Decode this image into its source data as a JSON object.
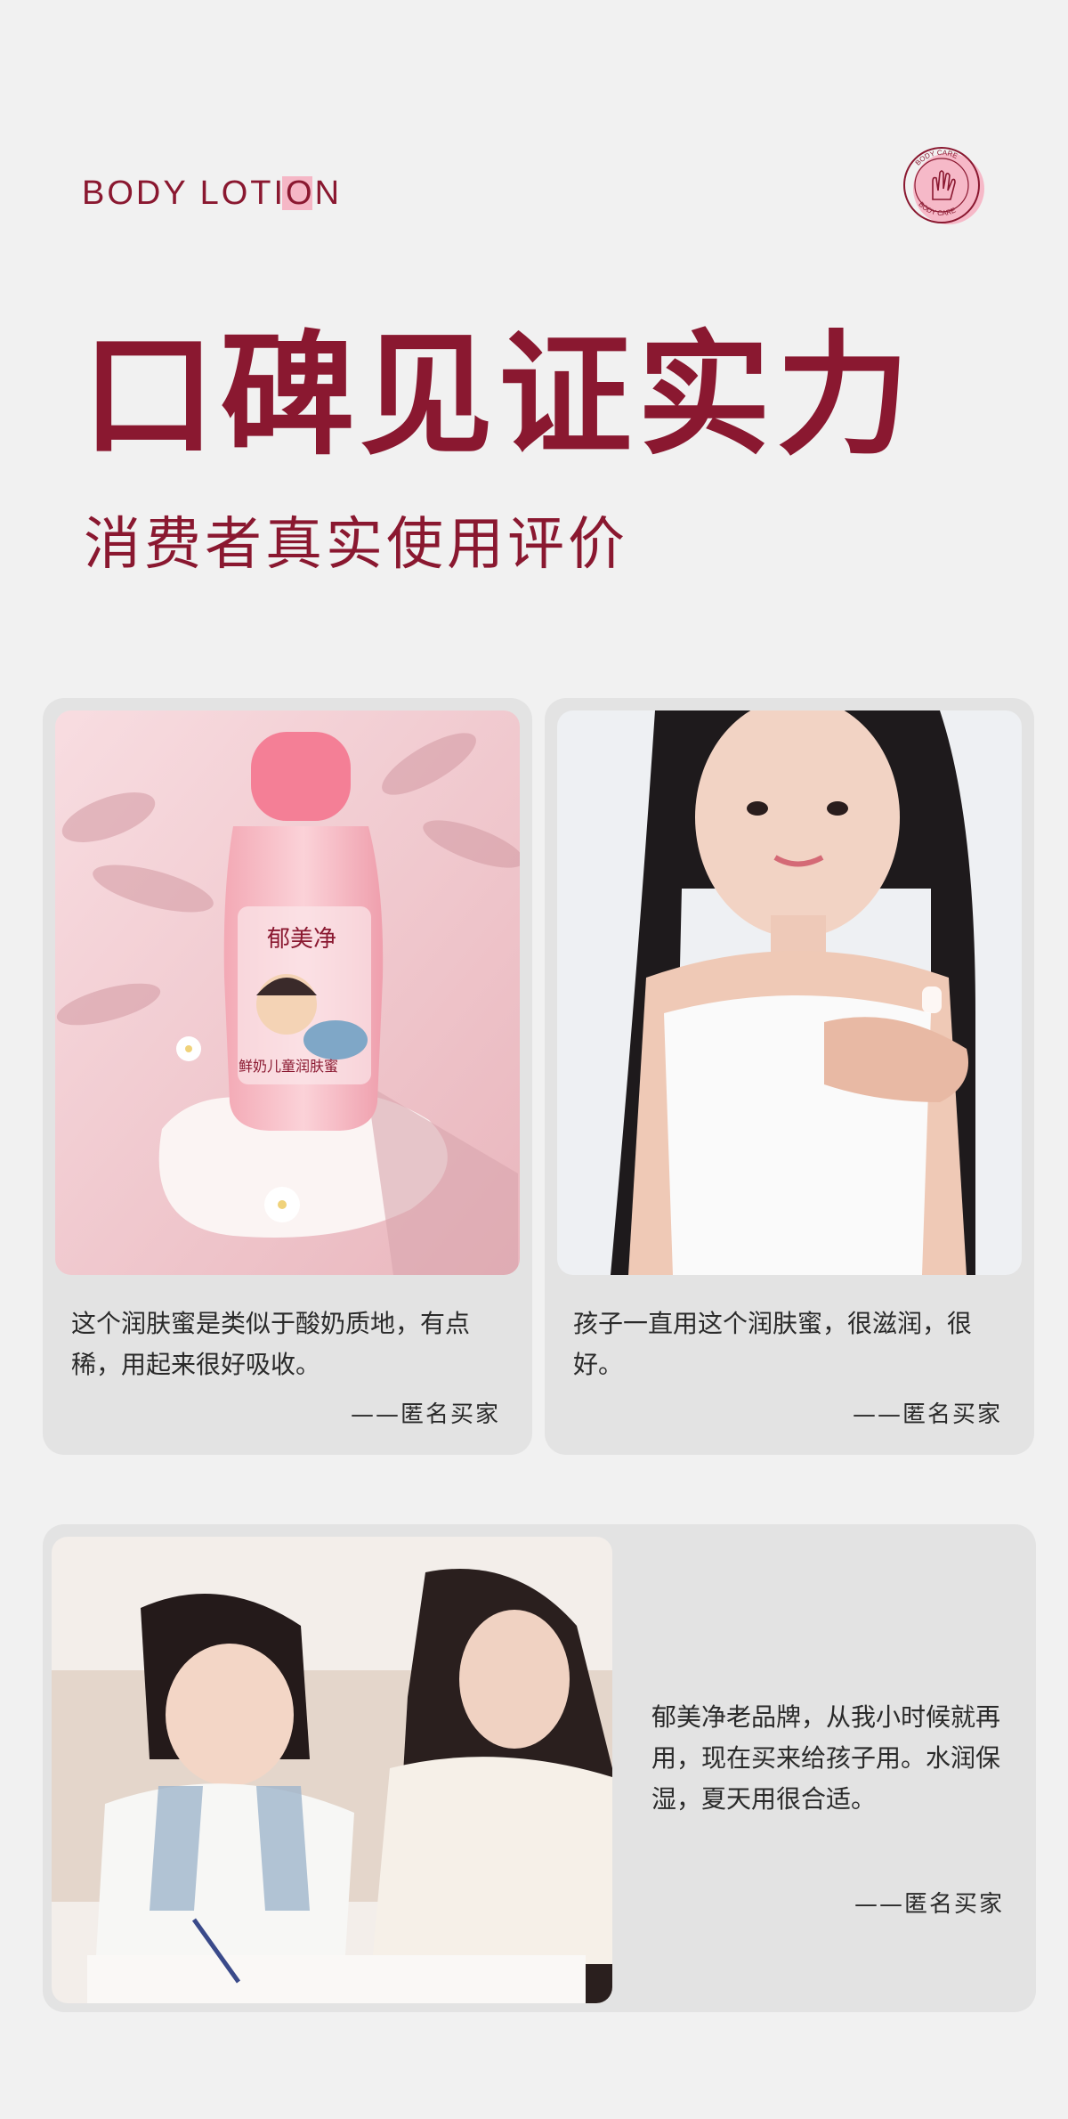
{
  "header": {
    "eyebrow_before": "BODY LOTI",
    "eyebrow_highlight": "O",
    "eyebrow_after": "N",
    "seal_text_top": "BODY CARE",
    "seal_text_bottom": "BODY CARE",
    "title": "口碑见证实力",
    "subtitle": "消费者真实使用评价"
  },
  "colors": {
    "brand": "#8a1830",
    "accent_pink": "#f5b7c6",
    "card_bg": "#e3e3e3",
    "page_bg": "#f1f1f1"
  },
  "reviews": [
    {
      "text": "这个润肤蜜是类似于酸奶质地，有点稀，用起来很好吸收。",
      "author": "——匿名买家"
    },
    {
      "text": "孩子一直用这个润肤蜜，很滋润，很好。",
      "author": "——匿名买家"
    },
    {
      "text": "郁美净老品牌，从我小时候就再用，现在买来给孩子用。水润保湿，夏天用很合适。",
      "author": "——匿名买家"
    }
  ],
  "product": {
    "brand_name": "郁美净",
    "product_name": "鲜奶儿童润肤蜜"
  }
}
